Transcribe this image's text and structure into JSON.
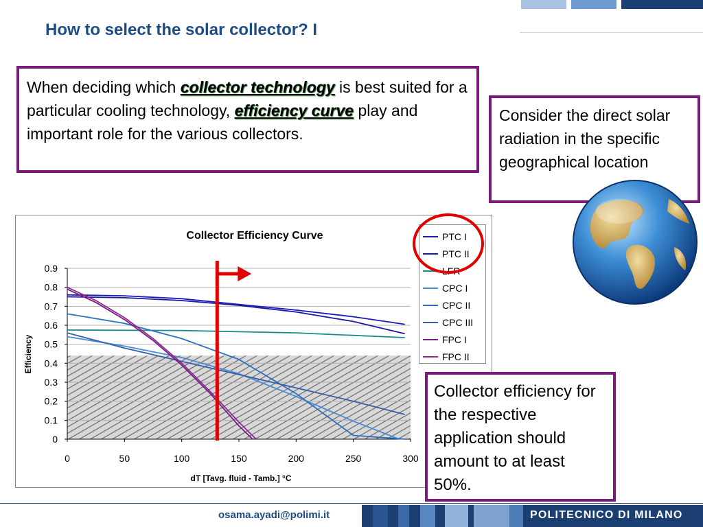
{
  "slide": {
    "title": "How to select the solar collector? I"
  },
  "callouts": {
    "top": {
      "part1": "When deciding which ",
      "em1": "collector technology",
      "part2": " is best suited for a particular cooling technology, ",
      "em2": "efficiency curve",
      "part3": " play and important role for the various collectors."
    },
    "right": "Consider the direct solar radiation in the specific geographical location",
    "bottom": "Collector  efficiency for the respective application should amount to at least 50%."
  },
  "footer": {
    "email": "osama.ayadi@polimi.it",
    "brand": "POLITECNICO DI MILANO"
  },
  "colors": {
    "title": "#1c4b86",
    "callout_border": "#7a1a7a",
    "marker": "#e00000",
    "highlight_circle": "#e00000"
  },
  "icons": {
    "globe": "globe-icon",
    "arrow": "right-arrow-icon"
  },
  "chart_data": {
    "type": "line",
    "title": "Collector Efficiency Curve",
    "xlabel": "dT [Tavg. fluid - Tamb.] °C",
    "ylabel": "Efficiency",
    "xlim": [
      0,
      300
    ],
    "ylim": [
      0,
      0.9
    ],
    "xticks": [
      0,
      50,
      100,
      150,
      200,
      250,
      300
    ],
    "yticks": [
      0,
      0.1,
      0.2,
      0.3,
      0.4,
      0.5,
      0.6,
      0.7,
      0.8,
      0.9
    ],
    "xtick_labels": [
      "0",
      "50",
      "100",
      "150",
      "200",
      "250",
      "300"
    ],
    "ytick_labels": [
      "0",
      "0.1",
      "0.2",
      "0.3",
      "0.4",
      "0.5",
      "0.6",
      "0.7",
      "0.8",
      "0.9"
    ],
    "grid": "horizontal",
    "legend": "top-right",
    "shaded_region": {
      "y_from": 0,
      "y_to": 0.44,
      "pattern": "hatched"
    },
    "marker_line": {
      "x": 131,
      "direction": "right"
    },
    "series": [
      {
        "name": "PTC I",
        "color": "#1a1ab8",
        "x": [
          0,
          50,
          100,
          150,
          200,
          250,
          295
        ],
        "values": [
          0.76,
          0.755,
          0.74,
          0.71,
          0.68,
          0.645,
          0.605
        ]
      },
      {
        "name": "PTC II",
        "color": "#1a1aa0",
        "x": [
          0,
          50,
          100,
          150,
          200,
          250,
          295
        ],
        "values": [
          0.75,
          0.745,
          0.73,
          0.705,
          0.67,
          0.62,
          0.555
        ]
      },
      {
        "name": "LFR",
        "color": "#1f8a8a",
        "x": [
          0,
          100,
          200,
          295
        ],
        "values": [
          0.575,
          0.572,
          0.56,
          0.535
        ]
      },
      {
        "name": "CPC I",
        "color": "#4a8ad4",
        "x": [
          0,
          50,
          100,
          150,
          200,
          250,
          290
        ],
        "values": [
          0.54,
          0.49,
          0.43,
          0.345,
          0.225,
          0.095,
          0.0
        ]
      },
      {
        "name": "CPC II",
        "color": "#2a70c0",
        "x": [
          0,
          50,
          100,
          150,
          200,
          250,
          295
        ],
        "values": [
          0.66,
          0.61,
          0.53,
          0.42,
          0.24,
          0.02,
          0.0
        ]
      },
      {
        "name": "CPC III",
        "color": "#3560a8",
        "x": [
          0,
          50,
          100,
          150,
          200,
          250,
          295
        ],
        "values": [
          0.56,
          0.48,
          0.41,
          0.34,
          0.27,
          0.2,
          0.13
        ]
      },
      {
        "name": "FPC I",
        "color": "#7a1a8a",
        "x": [
          0,
          25,
          50,
          75,
          100,
          125,
          150,
          162
        ],
        "values": [
          0.79,
          0.72,
          0.63,
          0.52,
          0.39,
          0.24,
          0.07,
          0.0
        ]
      },
      {
        "name": "FPC II",
        "color": "#8a2a8a",
        "x": [
          0,
          25,
          50,
          75,
          100,
          125,
          150,
          165
        ],
        "values": [
          0.8,
          0.73,
          0.64,
          0.53,
          0.4,
          0.25,
          0.09,
          0.0
        ]
      }
    ]
  }
}
